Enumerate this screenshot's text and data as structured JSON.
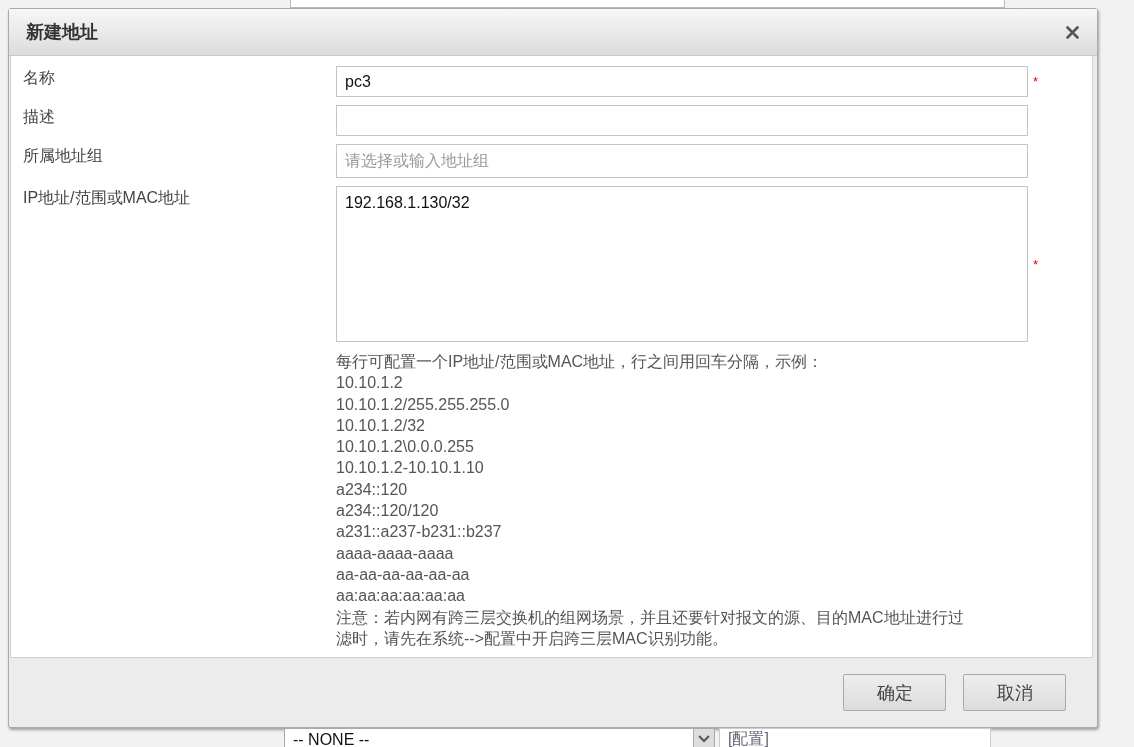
{
  "dialog": {
    "title": "新建地址",
    "fields": [
      {
        "label": "名称",
        "kind": "text",
        "value": "pc3",
        "required_mark": "*"
      },
      {
        "label": "描述",
        "kind": "text"
      },
      {
        "label": "所属地址组",
        "kind": "combo",
        "placeholder": "请选择或输入地址组"
      },
      {
        "label": "IP地址/范围或MAC地址",
        "kind": "textarea",
        "value": "192.168.1.130/32",
        "required_mark": "*"
      }
    ],
    "help": {
      "intro": "每行可配置一个IP地址/范围或MAC地址，行之间用回车分隔，示例：",
      "examples": [
        "10.10.1.2",
        "10.10.1.2/255.255.255.0",
        "10.10.1.2/32",
        "10.10.1.2\\0.0.0.255",
        "10.10.1.2-10.10.1.10",
        "a234::120",
        "a234::120/120",
        "a231::a237-b231::b237",
        "aaaa-aaaa-aaaa",
        "aa-aa-aa-aa-aa-aa",
        "aa:aa:aa:aa:aa:aa"
      ],
      "note": "注意：若内网有跨三层交换机的组网场景，并且还要针对报文的源、目的MAC地址进行过滤时，请先在系统-->配置中开启跨三层MAC识别功能。"
    },
    "buttons": [
      "确定",
      "取消"
    ]
  },
  "background": {
    "select_value": "-- NONE --",
    "link": "[配置]"
  }
}
